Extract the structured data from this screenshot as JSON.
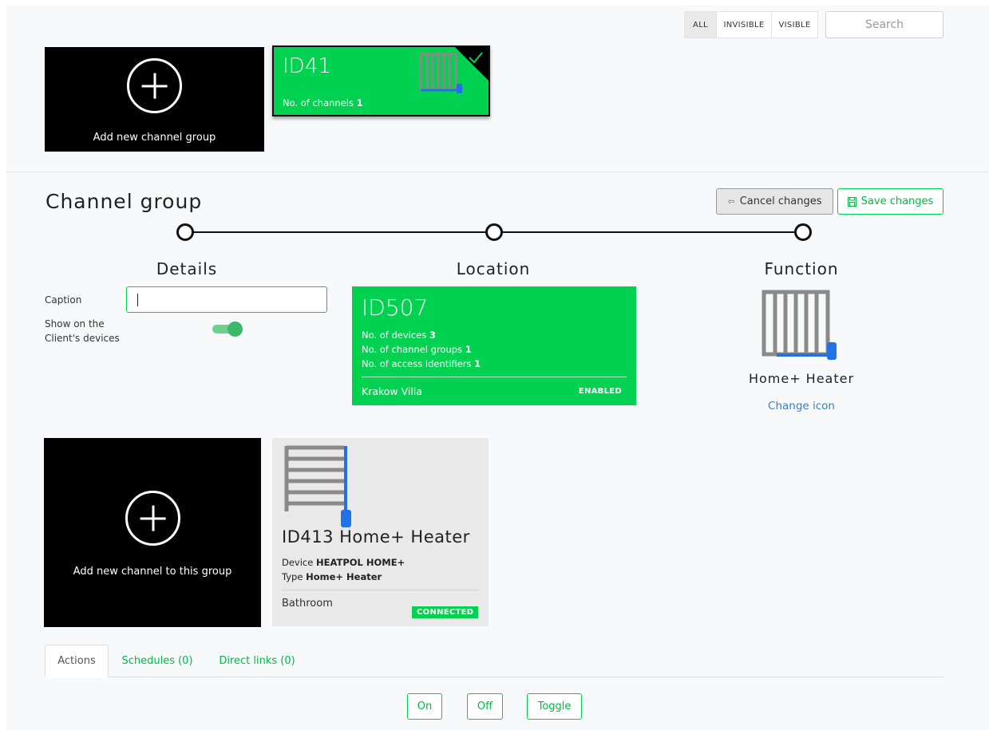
{
  "filters": {
    "all": "ALL",
    "invisible": "INVISIBLE",
    "visible": "VISIBLE"
  },
  "search": {
    "placeholder": "Search"
  },
  "group_list": {
    "add_tile_label": "Add new channel group",
    "selected_card": {
      "id_prefix": "ID",
      "id_number": "41",
      "channels_label": "No. of channels",
      "channels_value": "1",
      "icon": "radiator-icon"
    }
  },
  "editor": {
    "title": "Channel group",
    "cancel_label": "Cancel changes",
    "save_label": "Save changes",
    "steps": [
      "Details",
      "Location",
      "Function"
    ]
  },
  "details": {
    "caption_label": "Caption",
    "caption_value": "",
    "show_label_line1": "Show on the",
    "show_label_line2": "Client's devices",
    "show_on_devices": true
  },
  "location": {
    "id_prefix": "ID",
    "id_number": "507",
    "devices_label": "No. of devices",
    "devices_value": "3",
    "groups_label": "No. of channel groups",
    "groups_value": "1",
    "access_label": "No. of access identifiers",
    "access_value": "1",
    "name": "Krakow Villa",
    "status": "ENABLED"
  },
  "function": {
    "name": "Home+ Heater",
    "change_icon_label": "Change icon",
    "icon": "radiator-icon"
  },
  "channels": {
    "add_tile_label": "Add new channel to this group",
    "items": [
      {
        "title": "ID413 Home+ Heater",
        "device_label": "Device",
        "device_value": "HEATPOL HOME+",
        "type_label": "Type",
        "type_value": "Home+ Heater",
        "location": "Bathroom",
        "status": "CONNECTED",
        "icon": "heater-icon"
      }
    ]
  },
  "tabs": [
    "Actions",
    "Schedules (0)",
    "Direct links (0)"
  ],
  "actions": [
    "On",
    "Off",
    "Toggle"
  ],
  "colors": {
    "accent": "#00d150",
    "accent_text": "#00b845",
    "tile_dark": "#000000",
    "card_grey": "#e9e9e9"
  }
}
